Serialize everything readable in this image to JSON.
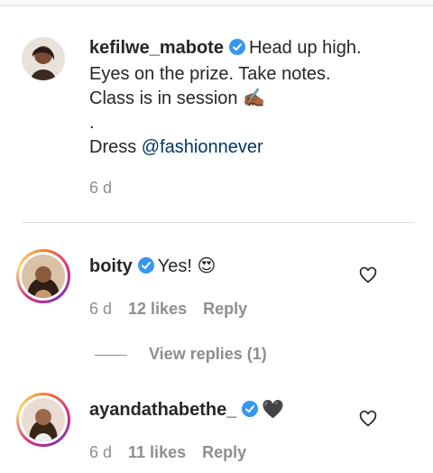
{
  "comments": [
    {
      "username": "kefilwe_mabote",
      "verified": true,
      "lines": [
        "Head up high.",
        "Eyes on the prize. Take notes.",
        "Class is in session ✍🏾",
        "."
      ],
      "dress_label": "Dress",
      "mention": "@fashionnever",
      "time": "6 d"
    },
    {
      "username": "boity",
      "verified": true,
      "text": "Yes! 😍",
      "time": "6 d",
      "likes": "12 likes",
      "reply_label": "Reply",
      "view_replies": "View replies (1)"
    },
    {
      "username": "ayandathabethe_",
      "verified": true,
      "text": "🖤",
      "time": "6 d",
      "likes": "11 likes",
      "reply_label": "Reply"
    }
  ],
  "icons": {
    "verified": "verified-badge-icon",
    "like": "heart-outline-icon"
  },
  "colors": {
    "verified": "#3897f0",
    "mention": "#00376b",
    "meta": "#8e8e8e"
  }
}
